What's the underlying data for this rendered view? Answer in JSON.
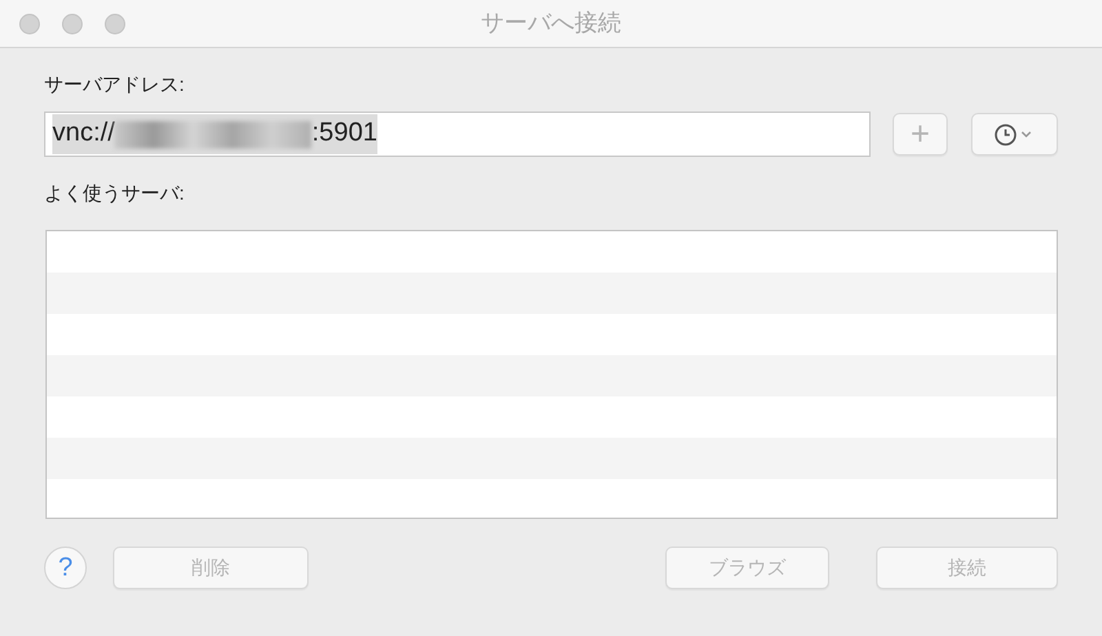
{
  "window": {
    "title": "サーバへ接続",
    "active": false
  },
  "address": {
    "label": "サーバアドレス:",
    "prefix": "vnc://",
    "suffix": ":5901",
    "redacted": true,
    "selected": true
  },
  "add_button": {
    "label": "+",
    "disabled": true
  },
  "history_button": {
    "disabled": false
  },
  "favorites": {
    "label": "よく使うサーバ:"
  },
  "help_button": {
    "label": "?"
  },
  "buttons": [
    {
      "label": "削除",
      "disabled": true
    },
    {
      "label": "ブラウズ",
      "disabled": true
    },
    {
      "label": "接続",
      "disabled": true
    }
  ]
}
